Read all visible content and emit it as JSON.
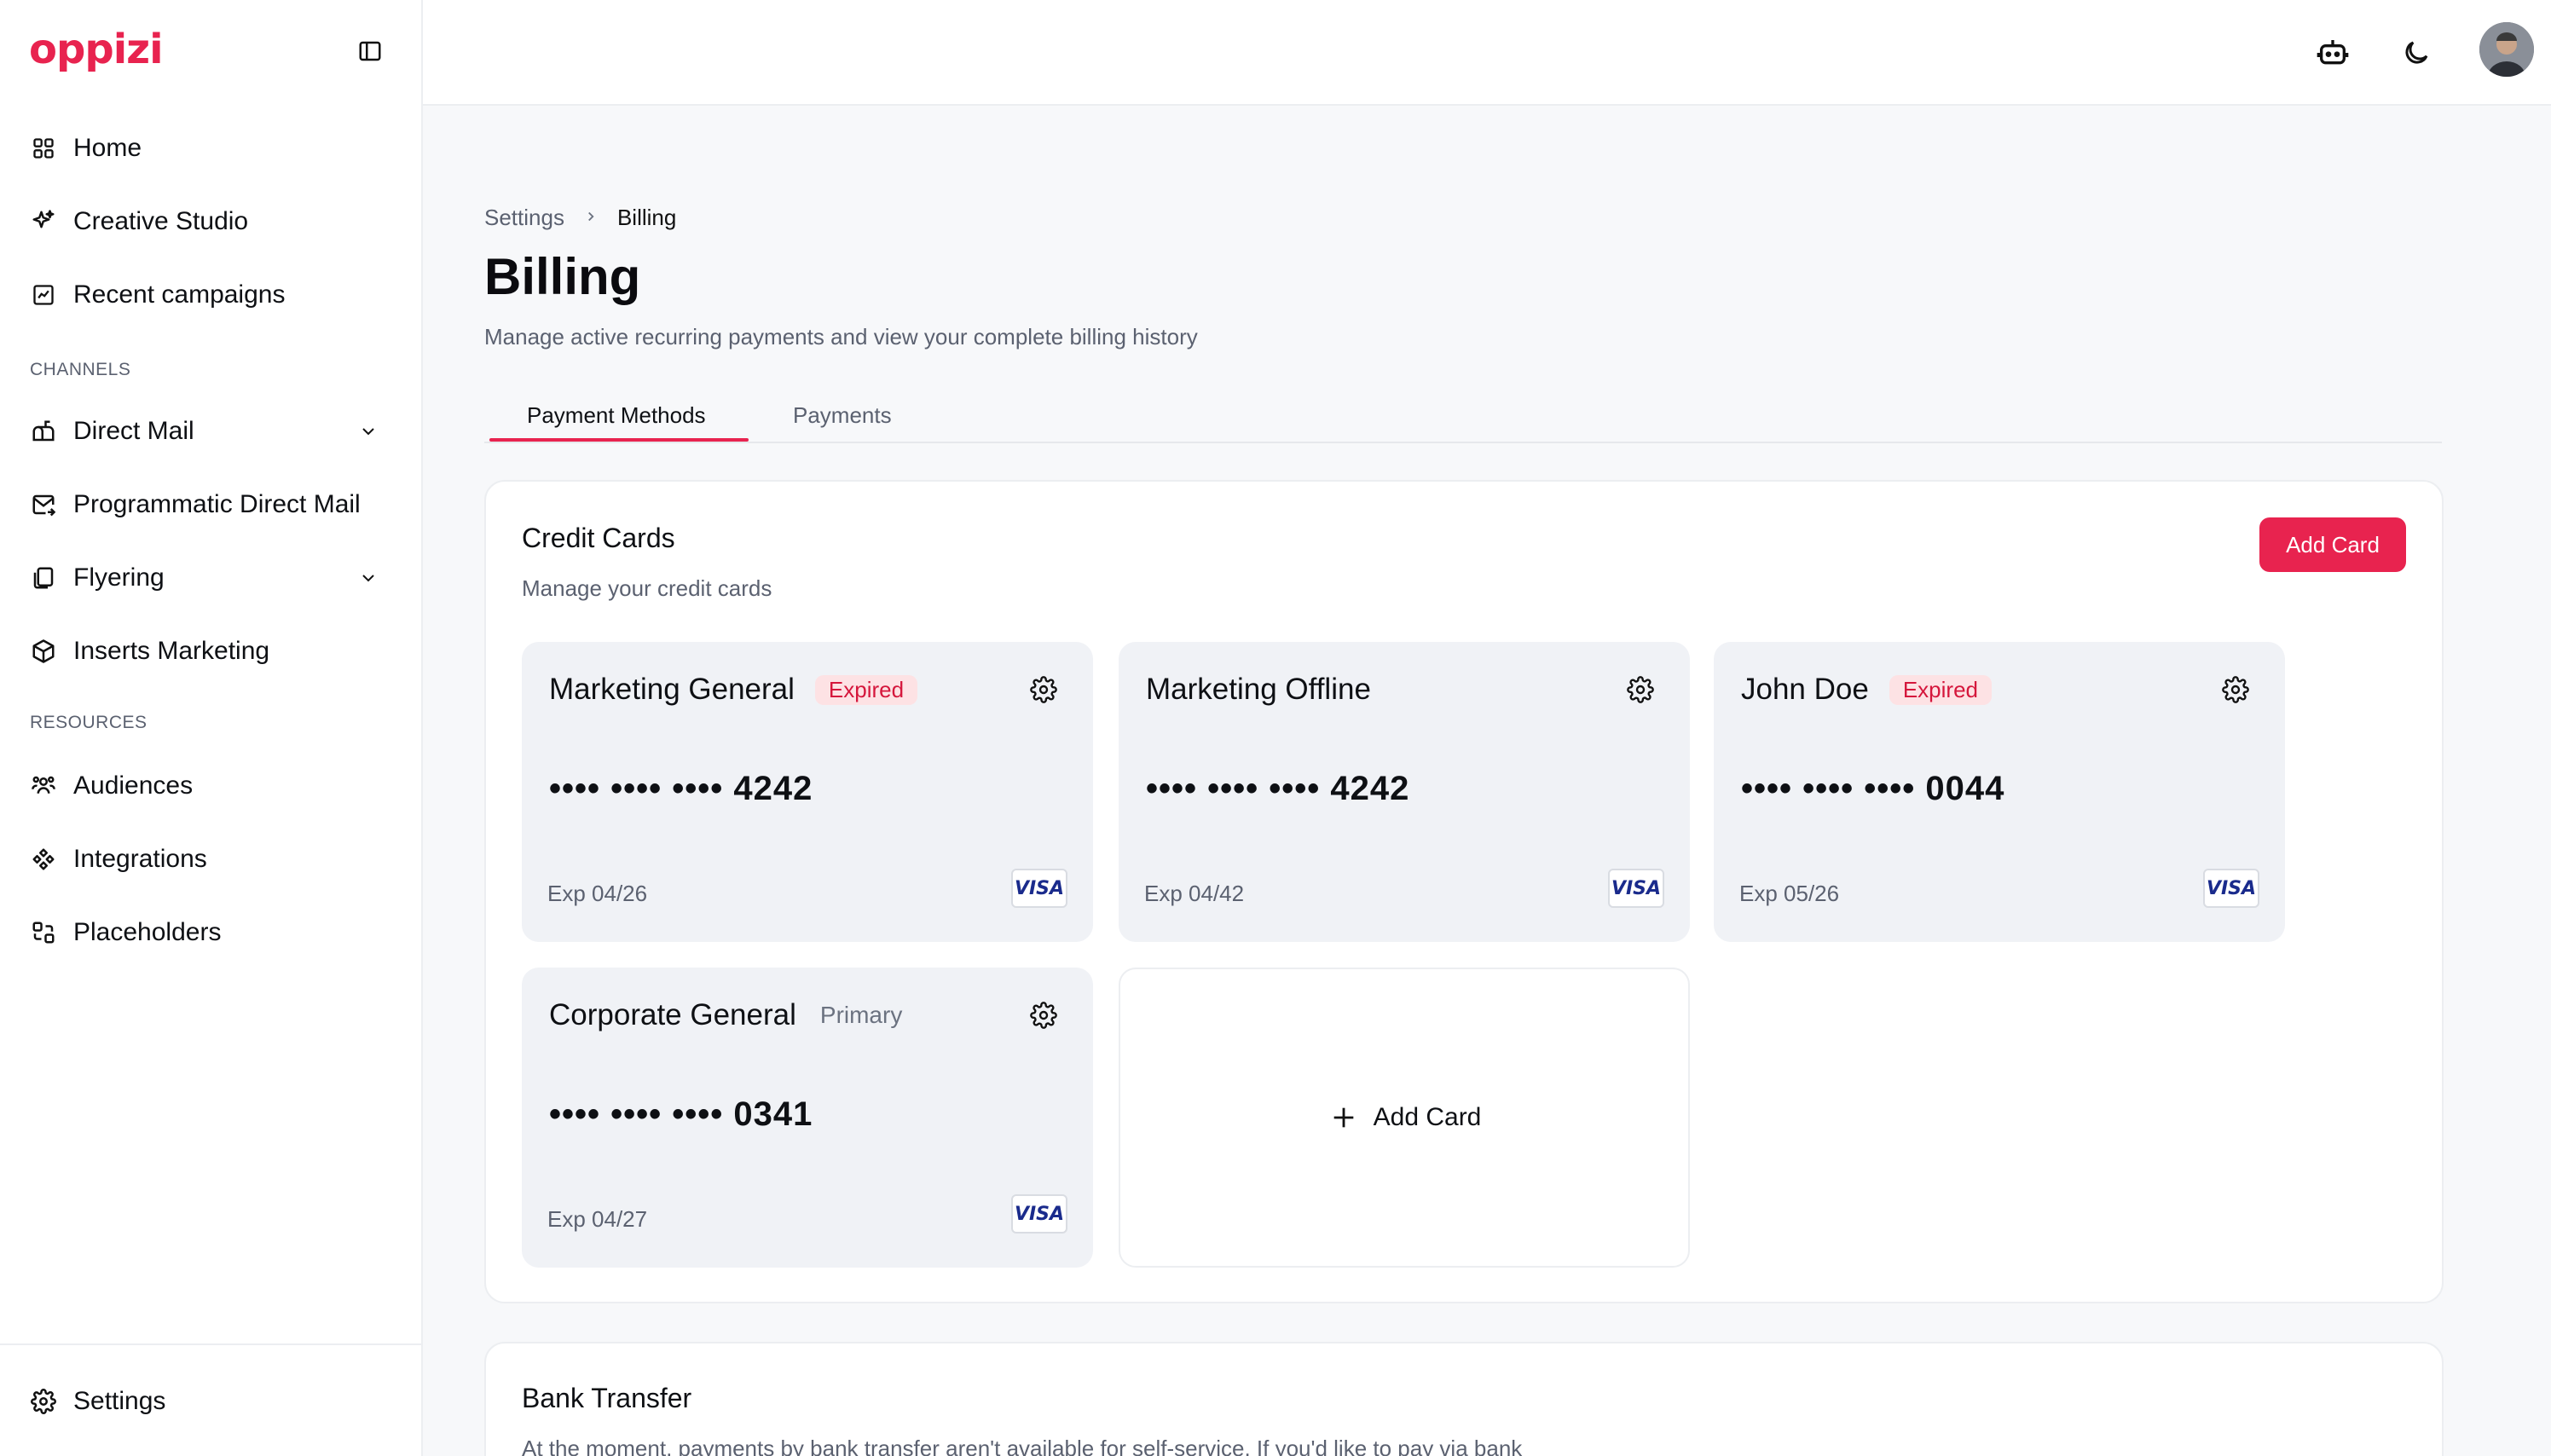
{
  "app": {
    "logo": "oppizi"
  },
  "sidebar": {
    "items_main": [
      {
        "label": "Home",
        "icon": "grid-icon"
      },
      {
        "label": "Creative Studio",
        "icon": "sparkles-icon"
      },
      {
        "label": "Recent campaigns",
        "icon": "chart-icon"
      }
    ],
    "channels_label": "CHANNELS",
    "channels": [
      {
        "label": "Direct Mail",
        "icon": "mailbox-icon",
        "expandable": true
      },
      {
        "label": "Programmatic Direct Mail",
        "icon": "mail-send-icon",
        "expandable": false
      },
      {
        "label": "Flyering",
        "icon": "flyer-icon",
        "expandable": true
      },
      {
        "label": "Inserts Marketing",
        "icon": "box-icon",
        "expandable": false
      }
    ],
    "resources_label": "RESOURCES",
    "resources": [
      {
        "label": "Audiences",
        "icon": "users-icon"
      },
      {
        "label": "Integrations",
        "icon": "integrations-icon"
      },
      {
        "label": "Placeholders",
        "icon": "placeholder-icon"
      }
    ],
    "settings_label": "Settings"
  },
  "breadcrumb": {
    "parent": "Settings",
    "current": "Billing"
  },
  "page": {
    "title": "Billing",
    "subtitle": "Manage active recurring payments and view your complete billing history"
  },
  "tabs": [
    {
      "label": "Payment Methods",
      "active": true
    },
    {
      "label": "Payments",
      "active": false
    }
  ],
  "credit_cards": {
    "title": "Credit Cards",
    "subtitle": "Manage your credit cards",
    "add_button": "Add Card",
    "add_tile_label": "Add Card",
    "cards": [
      {
        "name": "Marketing General",
        "badge": "Expired",
        "number": "•••• •••• •••• 4242",
        "exp": "Exp 04/26",
        "brand": "VISA"
      },
      {
        "name": "Marketing Offline",
        "badge": "",
        "number": "•••• •••• •••• 4242",
        "exp": "Exp 04/42",
        "brand": "VISA"
      },
      {
        "name": "John Doe",
        "badge": "Expired",
        "number": "•••• •••• •••• 0044",
        "exp": "Exp 05/26",
        "brand": "VISA"
      },
      {
        "name": "Corporate General",
        "badge": "Primary",
        "number": "•••• •••• •••• 0341",
        "exp": "Exp 04/27",
        "brand": "VISA"
      }
    ]
  },
  "bank_transfer": {
    "title": "Bank Transfer",
    "description": "At the moment, payments by bank transfer aren't available for self-service. If you'd like to pay via bank"
  },
  "colors": {
    "accent": "#e8234f",
    "card_bg": "#f0f2f6",
    "expired_bg": "#fde2e4",
    "expired_text": "#d5173c"
  }
}
